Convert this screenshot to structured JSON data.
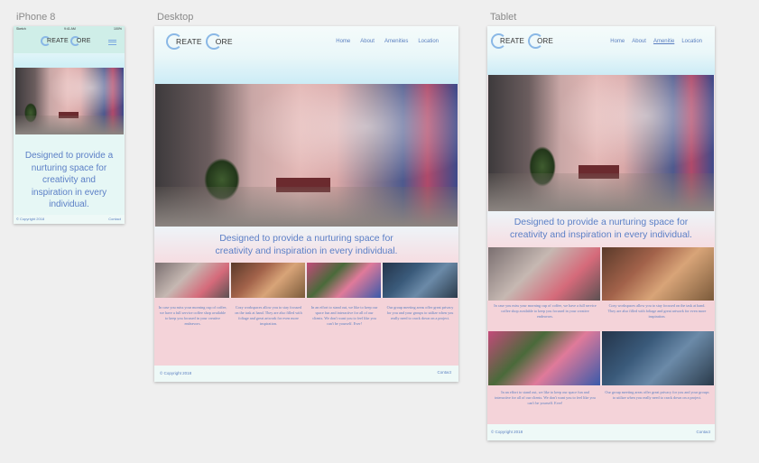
{
  "artboards": {
    "phone": {
      "label": "iPhone 8"
    },
    "desktop": {
      "label": "Desktop"
    },
    "tablet": {
      "label": "Tablet"
    }
  },
  "status_bar": {
    "carrier": "Sketch",
    "time": "9:41 AM",
    "battery": "100%"
  },
  "logo": {
    "c1": "C",
    "text1": "REATE",
    "c2": "C",
    "text2": "ORE"
  },
  "nav": {
    "home": "Home",
    "about": "About",
    "amenities": "Amenities",
    "amenities_tablet": "Amenitie",
    "location": "Location"
  },
  "tagline": "Designed to provide a nurturing space for creativity and inspiration in every individual.",
  "tagline_desktop_line1": "Designed to provide a nurturing space for",
  "tagline_desktop_line2": "creativity and inspiration in every individual.",
  "cards": [
    {
      "text": "In case you miss your morning cup of coffee, we have a full service coffee shop available to keep you focused in your creative endeavors."
    },
    {
      "text": "Cozy workspaces allow you to stay focused on the task at hand. They are also filled with foliage and great artwork for even more inspiration."
    },
    {
      "text": "In an effort to stand out, we like to keep our space fun and interactive for all of our clients. We don't want you to feel like you can't be yourself. Ever!"
    },
    {
      "text": "Our group meeting areas offer great privacy for you and your groups to utilize when you really need to crack down on a project."
    }
  ],
  "footer": {
    "copyright": "© Copyright 2018",
    "contact": "Contact"
  },
  "colors": {
    "header_bg": "#d9f3ef",
    "accent_blue": "#5a7fc0",
    "logo_ring": "#8ab8e6",
    "pink_bg": "#f6d6db"
  }
}
